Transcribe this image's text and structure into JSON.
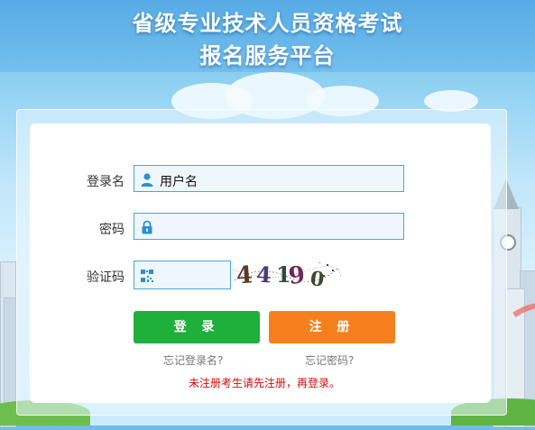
{
  "header": {
    "title_line1": "省级专业技术人员资格考试",
    "title_line2": "报名服务平台"
  },
  "form": {
    "username_label": "登录名",
    "username_value": "用户名",
    "password_label": "密码",
    "password_value": "",
    "captcha_label": "验证码",
    "captcha_value": "",
    "captcha_image_text": "44190"
  },
  "buttons": {
    "login_label": "登 录",
    "register_label": "注 册"
  },
  "links": {
    "forgot_username": "忘记登录名?",
    "forgot_password": "忘记密码?"
  },
  "notice": "未注册考生请先注册，再登录。",
  "colors": {
    "login_green": "#1faf3b",
    "register_orange": "#f67f1e",
    "notice_red": "#d40b0b",
    "field_border": "#49a7d8"
  },
  "icons": {
    "username": "user-icon",
    "password": "lock-icon",
    "captcha": "qr-code-icon"
  }
}
